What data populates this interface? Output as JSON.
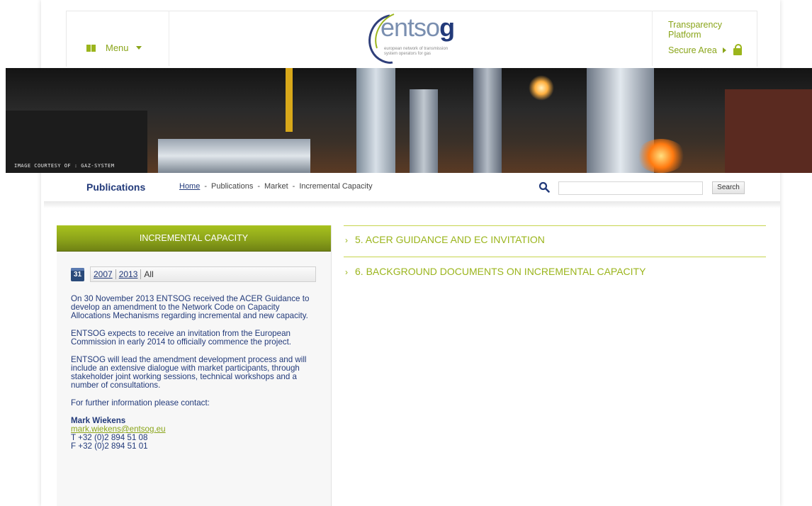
{
  "header": {
    "menu_label": "Menu",
    "logo_word": "entso",
    "logo_word_bold": "g",
    "logo_sub": "european network of transmission system operators for gas",
    "transparency_label": "Transparency Platform",
    "secure_area_label": "Secure Area"
  },
  "banner": {
    "credit": "IMAGE COURTESY OF : GAZ-SYSTEM"
  },
  "breadcrumb": {
    "section_title": "Publications",
    "items": [
      "Home",
      "Publications",
      "Market",
      "Incremental Capacity"
    ],
    "separator": "-"
  },
  "search": {
    "placeholder": "",
    "button_label": "Search"
  },
  "sidebar": {
    "heading": "INCREMENTAL CAPACITY",
    "calendar_day": "31",
    "years": [
      "2007",
      "2013"
    ],
    "all_label": "All",
    "paragraphs": [
      "On 30 November 2013 ENTSOG received the ACER Guidance to develop an amendment to the Network Code on Capacity Allocations Mechanisms regarding incremental and new capacity.",
      "ENTSOG expects to receive an invitation from the European Commission in early 2014 to officially commence the project.",
      "ENTSOG will lead the amendment development process and will include an extensive dialogue with market participants, through stakeholder joint working sessions, technical workshops and a number of consultations."
    ],
    "contact_label": "For further information please contact:",
    "contact_name": "Mark Wiekens",
    "contact_email": "mark.wiekens@entsog.eu",
    "contact_phone": "T +32 (0)2 894 51 08",
    "contact_fax": "F +32 (0)2 894 51 01"
  },
  "main": {
    "sections": [
      "5. ACER GUIDANCE AND EC INVITATION",
      "6. BACKGROUND DOCUMENTS ON INCREMENTAL CAPACITY"
    ]
  },
  "colors": {
    "brand_green": "#8aa51a",
    "brand_blue": "#223a7a"
  }
}
